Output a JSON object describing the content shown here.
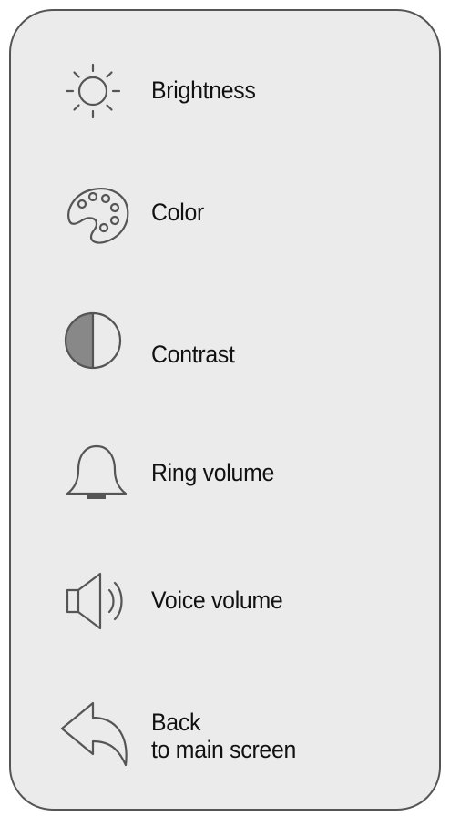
{
  "menu": {
    "items": [
      {
        "id": "brightness",
        "label": "Brightness",
        "icon": "sun-icon"
      },
      {
        "id": "color",
        "label": "Color",
        "icon": "palette-icon"
      },
      {
        "id": "contrast",
        "label": "Contrast",
        "icon": "contrast-icon"
      },
      {
        "id": "ring-volume",
        "label": "Ring volume",
        "icon": "bell-icon"
      },
      {
        "id": "voice-volume",
        "label": "Voice volume",
        "icon": "speaker-icon"
      },
      {
        "id": "back",
        "label_line1": "Back",
        "label_line2": "to main screen",
        "icon": "back-arrow-icon"
      }
    ]
  },
  "colors": {
    "panel_background": "#ebebeb",
    "panel_border": "#555555",
    "icon_stroke": "#555555",
    "contrast_fill": "#888888",
    "text": "#111111"
  }
}
